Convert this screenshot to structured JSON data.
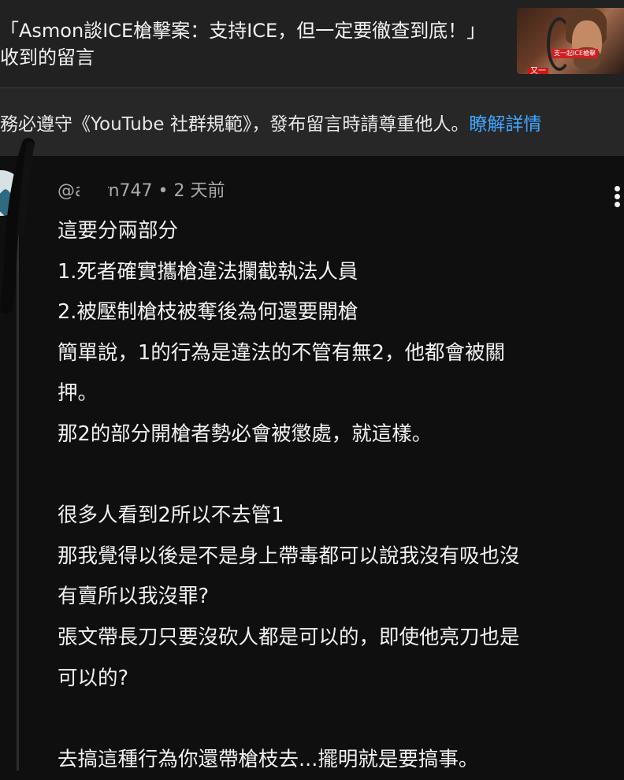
{
  "video": {
    "title_line1": "「Asmon談ICE槍擊案：支持ICE，但一定要徹查到底！」",
    "title_line2": "收到的留言",
    "thumbnail_badge": "支一起ICE槍擊",
    "thumbnail_corner": "又一"
  },
  "notice": {
    "text": "務必遵守《YouTube 社群規範》，發布留言時請尊重他人。",
    "link": "瞭解詳情"
  },
  "comment": {
    "author": "@a    orn747",
    "separator": "•",
    "time": "2 天前",
    "lines": [
      "這要分兩部分",
      "1.死者確實攜槍違法攔截執法人員",
      "2.被壓制槍枝被奪後為何還要開槍",
      "簡單說，1的行為是違法的不管有無2，他都會被關",
      "押。",
      "那2的部分開槍者勢必會被懲處，就這樣。",
      "",
      "很多人看到2所以不去管1",
      "那我覺得以後是不是身上帶毒都可以說我沒有吸也沒",
      "有賣所以我沒罪?",
      "張文帶長刀只要沒砍人都是可以的，即使他亮刀也是",
      "可以的?",
      "",
      "去搞這種行為你還帶槍枝去...擺明就是要搞事。"
    ]
  },
  "icons": {
    "menu": "more-vert-icon",
    "avatar": "avatar"
  },
  "colors": {
    "background": "#0f0f0f",
    "header": "#212121",
    "notice": "#272727",
    "link": "#3ea6ff",
    "meta": "#aaaaaa"
  }
}
